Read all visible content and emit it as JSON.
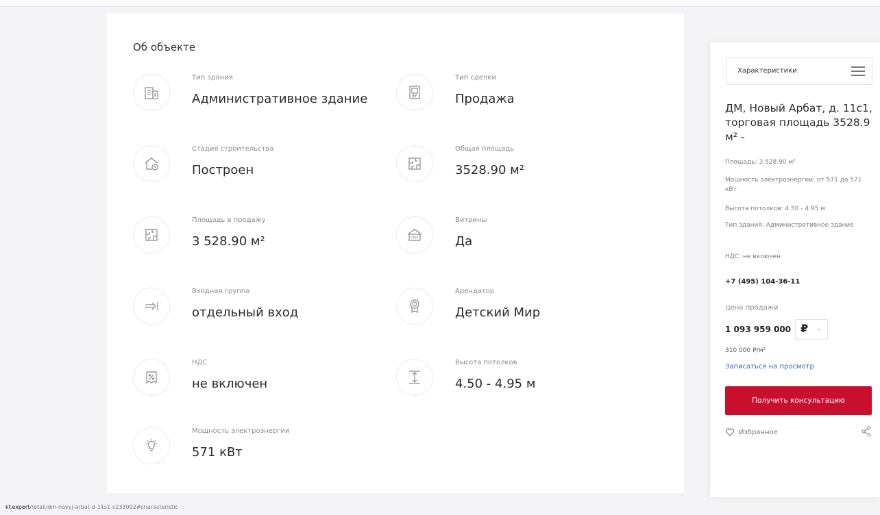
{
  "section_title": "Об объекте",
  "features": [
    {
      "label": "Тип здания",
      "value": "Административное здание",
      "icon": "office-building-icon"
    },
    {
      "label": "Тип сделки",
      "value": "Продажа",
      "icon": "contract-document-icon"
    },
    {
      "label": "Стадия строительства",
      "value": "Построен",
      "icon": "house-clock-icon"
    },
    {
      "label": "Общая площадь",
      "value": "3528.90 м²",
      "icon": "floor-plan-icon"
    },
    {
      "label": "Площадь в продажу",
      "value": "3 528.90 м²",
      "icon": "floor-plan-icon"
    },
    {
      "label": "Витрины",
      "value": "Да",
      "icon": "storefront-open-icon"
    },
    {
      "label": "Входная группа",
      "value": "отдельный вход",
      "icon": "entrance-arrow-icon"
    },
    {
      "label": "Арендатор",
      "value": "Детский Мир",
      "icon": "tenant-badge-icon"
    },
    {
      "label": "НДС",
      "value": "не включен",
      "icon": "percent-receipt-icon"
    },
    {
      "label": "Высота потолков",
      "value": "4.50 - 4.95 м",
      "icon": "ceiling-height-icon"
    },
    {
      "label": "Мощность электроэнергии",
      "value": "571 кВт",
      "icon": "light-bulb-icon"
    }
  ],
  "sidebar": {
    "select_label": "Характеристики",
    "title": "ДМ, Новый Арбат, д. 11с1, торговая площадь 3528.9 м² -",
    "info": [
      "Площадь: 3 528.90 м²",
      "Мощность электроэнергии: от 571 до 571 кВт",
      "Высота потолков: 4.50 - 4.95 м",
      "Тип здания: Административное здание",
      "НДС: не включен"
    ],
    "phone": "+7 (495) 104-36-11",
    "price_label": "Цена продажи",
    "price": "1 093 959 000",
    "currency": "₽",
    "price_per_m": "310 000 ₽/м²",
    "viewing_link": "Записаться на просмотр",
    "cta": "Получить консультацию",
    "favorites": "Избранное"
  },
  "status_bar": {
    "host": "kf.expert",
    "path": "/retail/dm-novyj-arbat-d-11s1-s233092#characteristic"
  },
  "colors": {
    "accent": "#c8102e",
    "link": "#2e6db4"
  }
}
